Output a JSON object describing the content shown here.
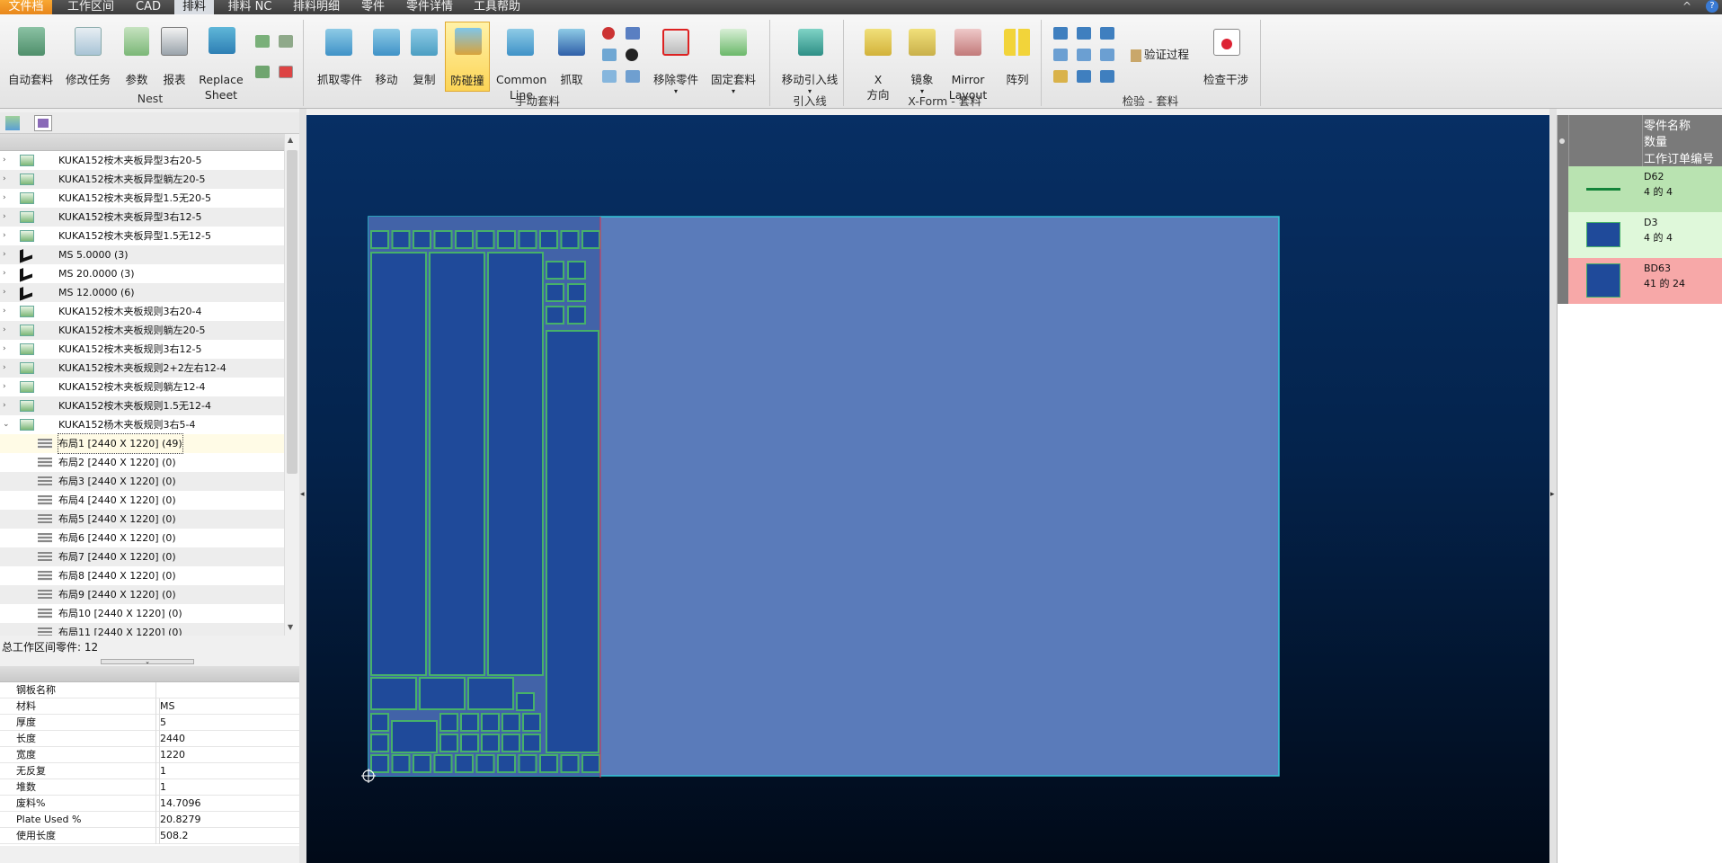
{
  "menu": {
    "tabs": [
      "文件档",
      "工作区间",
      "CAD",
      "排料",
      "排料 NC",
      "排料明细",
      "零件",
      "零件详情",
      "工具帮助"
    ],
    "active": "排料",
    "window_controls": [
      "^",
      "?"
    ]
  },
  "ribbon": {
    "nest": {
      "auto_nest": "自动套料",
      "modify_task": "修改任务",
      "params": "参数",
      "report": "报表",
      "replace_sheet_1": "Replace",
      "replace_sheet_2": "Sheet",
      "group": "Nest"
    },
    "manual": {
      "grab_part": "抓取零件",
      "move": "移动",
      "copy": "复制",
      "anti_collision": "防碰撞",
      "common_line_1": "Common",
      "common_line_2": "Line",
      "grab": "抓取",
      "remove_part": "移除零件",
      "fix_nest": "固定套料",
      "group": "手动套料"
    },
    "leadin": {
      "move_leadin": "移动引入线",
      "group": "引入线"
    },
    "xform": {
      "x_dir_1": "X",
      "x_dir_2": "方向",
      "mirror_cn": "镜象",
      "mirror_layout_1": "Mirror",
      "mirror_layout_2": "Layout",
      "array": "阵列",
      "group": "X-Form - 套料"
    },
    "check": {
      "verify": "验证过程",
      "check_interference": "检查干涉",
      "group": "检验 - 套料"
    }
  },
  "tree": {
    "items": [
      {
        "label": "KUKA152桉木夹板异型3右20-5",
        "type": "part"
      },
      {
        "label": "KUKA152桉木夹板异型躺左20-5",
        "type": "part"
      },
      {
        "label": "KUKA152桉木夹板异型1.5无20-5",
        "type": "part"
      },
      {
        "label": "KUKA152桉木夹板异型3右12-5",
        "type": "part"
      },
      {
        "label": "KUKA152桉木夹板异型1.5无12-5",
        "type": "part"
      },
      {
        "label": "MS 5.0000 (3)",
        "type": "material"
      },
      {
        "label": "MS 20.0000 (3)",
        "type": "material"
      },
      {
        "label": "MS 12.0000 (6)",
        "type": "material"
      },
      {
        "label": "KUKA152桉木夹板规则3右20-4",
        "type": "part"
      },
      {
        "label": "KUKA152桉木夹板规则躺左20-5",
        "type": "part"
      },
      {
        "label": "KUKA152桉木夹板规则3右12-5",
        "type": "part"
      },
      {
        "label": "KUKA152桉木夹板规则2+2左右12-4",
        "type": "part"
      },
      {
        "label": "KUKA152桉木夹板规则躺左12-4",
        "type": "part"
      },
      {
        "label": "KUKA152桉木夹板规则1.5无12-4",
        "type": "part"
      },
      {
        "label": "KUKA152杨木夹板规则3右5-4",
        "type": "part",
        "expanded": true
      },
      {
        "label": "布局1 [2440 X 1220]  (49)",
        "type": "layout",
        "selected": true
      },
      {
        "label": "布局2 [2440 X 1220]  (0)",
        "type": "layout"
      },
      {
        "label": "布局3 [2440 X 1220]  (0)",
        "type": "layout"
      },
      {
        "label": "布局4 [2440 X 1220]  (0)",
        "type": "layout"
      },
      {
        "label": "布局5 [2440 X 1220]  (0)",
        "type": "layout"
      },
      {
        "label": "布局6 [2440 X 1220]  (0)",
        "type": "layout"
      },
      {
        "label": "布局7 [2440 X 1220]  (0)",
        "type": "layout"
      },
      {
        "label": "布局8 [2440 X 1220]  (0)",
        "type": "layout"
      },
      {
        "label": "布局9 [2440 X 1220]  (0)",
        "type": "layout"
      },
      {
        "label": "布局10 [2440 X 1220]  (0)",
        "type": "layout"
      },
      {
        "label": "布局11 [2440 X 1220]  (0)",
        "type": "layout"
      }
    ]
  },
  "total_parts": "总工作区间零件: 12",
  "properties": [
    {
      "key": "钢板名称",
      "value": ""
    },
    {
      "key": "材料",
      "value": "MS"
    },
    {
      "key": "厚度",
      "value": "5"
    },
    {
      "key": "长度",
      "value": "2440"
    },
    {
      "key": "宽度",
      "value": "1220"
    },
    {
      "key": "无反复",
      "value": "1"
    },
    {
      "key": "堆数",
      "value": "1"
    },
    {
      "key": "废料%",
      "value": "14.7096"
    },
    {
      "key": "Plate Used %",
      "value": "20.8279"
    },
    {
      "key": "使用长度",
      "value": "508.2"
    }
  ],
  "parts_panel": {
    "headers": [
      "零件名称",
      "数量",
      "工作订单编号"
    ],
    "parts": [
      {
        "name": "D62",
        "qty": "4 的 4",
        "bg": "#b9e3b1",
        "swatch": "line"
      },
      {
        "name": "D3",
        "qty": "4 的 4",
        "bg": "#dff8da",
        "swatch": "box"
      },
      {
        "name": "BD63",
        "qty": "41 的 24",
        "bg": "#f7a8a8",
        "swatch": "box"
      }
    ]
  },
  "colors": {
    "plate": "#5a7bba",
    "part_fill": "#1f4a9a",
    "part_edge": "#46b16a",
    "plate_edge": "#33c7d8",
    "canvas_top": "#072f64"
  }
}
